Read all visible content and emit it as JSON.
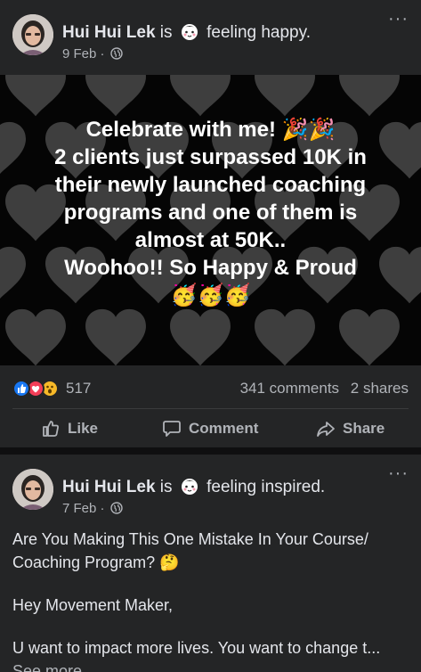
{
  "posts": [
    {
      "author": "Hui Hui Lek",
      "is_word": "is",
      "feeling": "feeling happy.",
      "date": "9 Feb",
      "separator": "·",
      "more": "···",
      "photo_text": {
        "line1": "Celebrate with me! 🎉🎉",
        "line2": "2 clients just surpassed 10K in",
        "line3": "their newly launched coaching",
        "line4": "programs and one of them is",
        "line5": "almost at 50K..",
        "line6": "Woohoo!! So Happy & Proud",
        "line7": "🥳🥳🥳"
      },
      "reaction_count": "517",
      "comments": "341 comments",
      "shares": "2 shares",
      "actions": {
        "like": "Like",
        "comment": "Comment",
        "share": "Share"
      }
    },
    {
      "author": "Hui Hui Lek",
      "is_word": "is",
      "feeling": "feeling inspired.",
      "date": "7 Feb",
      "separator": "·",
      "more": "···",
      "para1": "Are You Making This One Mistake In Your Course/ Coaching Program? 🤔",
      "para2": "Hey Movement Maker,",
      "para3": "U want to impact more lives. You want to change t...",
      "see_more": "See more"
    }
  ],
  "colors": {
    "card": "#242526",
    "page": "#0f0f10",
    "text": "#e4e6eb",
    "muted": "#b0b3b8",
    "like_blue": "#1877f2",
    "love_red": "#f33e58",
    "wow_yellow": "#f7b928"
  },
  "icons": [
    "globe-icon",
    "like-icon",
    "comment-icon",
    "share-icon",
    "more-icon",
    "feeling-face-icon"
  ]
}
